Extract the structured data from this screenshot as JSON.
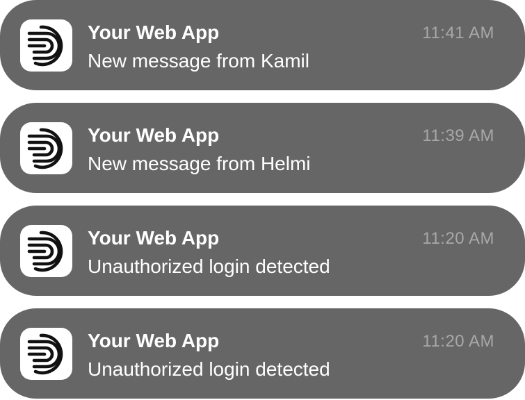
{
  "notifications": [
    {
      "app_name": "Your Web App",
      "message": "New message from Kamil",
      "time": "11:41 AM",
      "icon": "app-logo-icon"
    },
    {
      "app_name": "Your Web App",
      "message": "New message from Helmi",
      "time": "11:39 AM",
      "icon": "app-logo-icon"
    },
    {
      "app_name": "Your Web App",
      "message": "Unauthorized login detected",
      "time": "11:20 AM",
      "icon": "app-logo-icon"
    },
    {
      "app_name": "Your Web App",
      "message": "Unauthorized login detected",
      "time": "11:20 AM",
      "icon": "app-logo-icon"
    }
  ],
  "colors": {
    "card_background": "#666666",
    "icon_background": "#ffffff",
    "text_primary": "#ffffff",
    "text_secondary": "#a8a8a8"
  }
}
